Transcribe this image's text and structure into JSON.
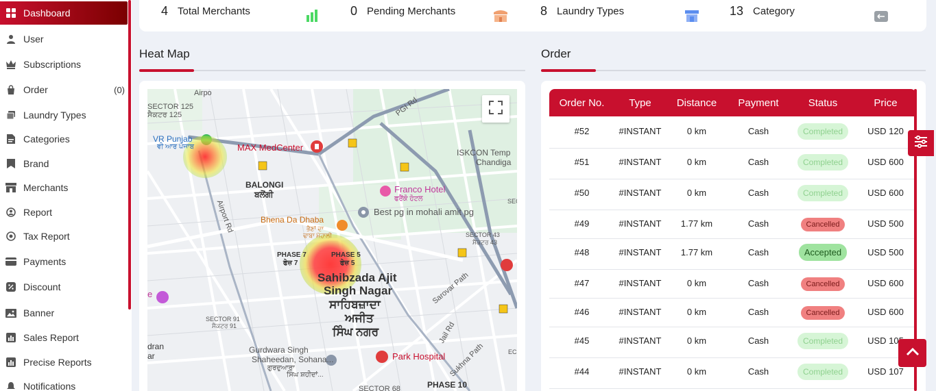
{
  "sidebar": {
    "items": [
      {
        "label": "Dashboard",
        "icon": "grid-icon"
      },
      {
        "label": "User",
        "icon": "user-icon"
      },
      {
        "label": "Subscriptions",
        "icon": "crown-icon"
      },
      {
        "label": "Order",
        "icon": "shopping-bag-icon",
        "badge": "(0)"
      },
      {
        "label": "Laundry Types",
        "icon": "layers-icon"
      },
      {
        "label": "Categories",
        "icon": "file-icon"
      },
      {
        "label": "Brand",
        "icon": "bookmark-icon"
      },
      {
        "label": "Merchants",
        "icon": "store-icon"
      },
      {
        "label": "Report",
        "icon": "user-report-icon"
      },
      {
        "label": "Tax Report",
        "icon": "tax-icon"
      },
      {
        "label": "Payments",
        "icon": "card-icon"
      },
      {
        "label": "Discount",
        "icon": "discount-icon"
      },
      {
        "label": "Banner",
        "icon": "image-icon"
      },
      {
        "label": "Sales Report",
        "icon": "chart-icon"
      },
      {
        "label": "Precise Reports",
        "icon": "chart-icon"
      },
      {
        "label": "Notifications",
        "icon": "bell-icon"
      }
    ]
  },
  "stats": [
    {
      "value": "4",
      "label": "Total Merchants",
      "icon": "bar-chart-icon",
      "color": "#4cd964"
    },
    {
      "value": "0",
      "label": "Pending Merchants",
      "icon": "shop-icon",
      "color": "#f0a070"
    },
    {
      "value": "8",
      "label": "Laundry Types",
      "icon": "storefront-icon",
      "color": "#5b8def"
    },
    {
      "value": "13",
      "label": "Category",
      "icon": "category-icon",
      "color": "#9aa0a6"
    }
  ],
  "heatmap": {
    "title": "Heat Map",
    "labels": {
      "sector125": "SECTOR 125",
      "sector125_pa": "ਸੈਕਟਰ 125",
      "vr_punjab": "VR Punjab",
      "vr_punjab_pa": "ਵੀ ਆਰ ਪੰਜਾਬ",
      "max": "MAX MedCenter",
      "balongi": "BALONGI",
      "balongi_pa": "ਬਲੋਂਗੀ",
      "franco": "Franco Hotel",
      "franco_pa": "ਫਰੈਂਕੋ ਹੋਟਲ",
      "iskcon": "ISKCON Temp",
      "chandiga": "Chandiga",
      "pgi": "PGI Rd",
      "bhena": "Bhena Da Dhaba",
      "bhena_pa1": "ਭੈਣਾਂ ਦਾ",
      "bhena_pa2": "ਢਾਬਾ ਮੋਹਾਲੀ",
      "best_pg": "Best pg in mohali amit pg",
      "sector43": "SECTOR 43",
      "sector43_pa": "ਸੈਕਟਰ 43",
      "phase7": "PHASE 7",
      "phase7_pa": "ਫੇਜ਼ 7",
      "phase5": "PHASE 5",
      "phase5_pa": "ਫੇਜ਼ 5",
      "sas1": "Sahibzada Ajit",
      "sas2": "Singh Nagar",
      "sas_pa1": "ਸਾਹਿਬਜ਼ਾਦਾ",
      "sas_pa2": "ਅਜੀਤ",
      "sas_pa3": "ਸਿੰਘ ਨਗਰ",
      "sarovar": "Sarovar Path",
      "sector91": "SECTOR 91",
      "sector91_pa": "ਸੈਕਟਰ 91",
      "jail": "Jail Rd",
      "gurdwara1": "Gurdwara Singh",
      "gurdwara2": "Shaheedan, Sohana...",
      "gurdwara_pa1": "ਗੁਰਦੁਆਰਾ",
      "gurdwara_pa2": "ਸਿੰਘ ਸ਼ਹੀਦਾਂ...",
      "park": "Park Hospital",
      "sukhna": "Sukhna Path",
      "sector68": "SECTOR 68",
      "phase10": "PHASE 10",
      "airport": "Airport Rd",
      "airpo": "Airpo",
      "dran": "dran",
      "ar": "ar",
      "e": "e",
      "sec": "SEC",
      "ec": "EC",
      "route5": "5"
    }
  },
  "orders": {
    "title": "Order",
    "columns": [
      "Order No.",
      "Type",
      "Distance",
      "Payment",
      "Status",
      "Price"
    ],
    "rows": [
      {
        "no": "#52",
        "type": "#INSTANT",
        "distance": "0 km",
        "payment": "Cash",
        "status": "Completed",
        "price": "USD 120"
      },
      {
        "no": "#51",
        "type": "#INSTANT",
        "distance": "0 km",
        "payment": "Cash",
        "status": "Completed",
        "price": "USD 600"
      },
      {
        "no": "#50",
        "type": "#INSTANT",
        "distance": "0 km",
        "payment": "Cash",
        "status": "Completed",
        "price": "USD 600"
      },
      {
        "no": "#49",
        "type": "#INSTANT",
        "distance": "1.77 km",
        "payment": "Cash",
        "status": "Cancelled",
        "price": "USD 500"
      },
      {
        "no": "#48",
        "type": "#INSTANT",
        "distance": "1.77 km",
        "payment": "Cash",
        "status": "Accepted",
        "price": "USD 500"
      },
      {
        "no": "#47",
        "type": "#INSTANT",
        "distance": "0 km",
        "payment": "Cash",
        "status": "Cancelled",
        "price": "USD 600"
      },
      {
        "no": "#46",
        "type": "#INSTANT",
        "distance": "0 km",
        "payment": "Cash",
        "status": "Cancelled",
        "price": "USD 600"
      },
      {
        "no": "#45",
        "type": "#INSTANT",
        "distance": "0 km",
        "payment": "Cash",
        "status": "Completed",
        "price": "USD 105"
      },
      {
        "no": "#44",
        "type": "#INSTANT",
        "distance": "0 km",
        "payment": "Cash",
        "status": "Completed",
        "price": "USD 107"
      }
    ]
  },
  "colors": {
    "accent": "#c8102e",
    "completed_bg": "#d6f5d6",
    "cancelled_bg": "#f08080",
    "accepted_bg": "#9fe39f"
  }
}
